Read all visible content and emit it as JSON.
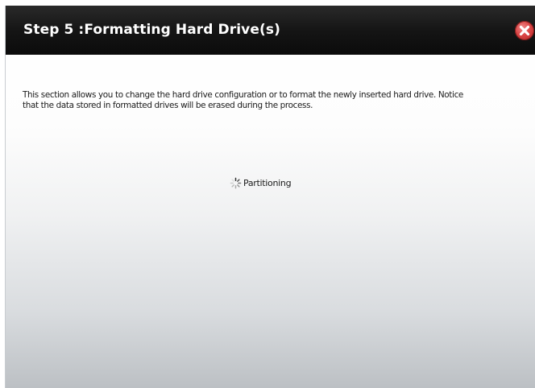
{
  "dialog": {
    "title": "Step 5 :Formatting Hard Drive(s)",
    "close_icon": "close-icon",
    "description_line1": "This section allows you to change the hard drive configuration or to format the newly inserted hard drive. Notice",
    "description_line2": "that the data stored in formatted drives will be erased during the process.",
    "status_text": "Partitioning",
    "status_icon": "loading-spinner-icon"
  },
  "colors": {
    "titlebar": "#151515",
    "close_button": "#d94545"
  }
}
